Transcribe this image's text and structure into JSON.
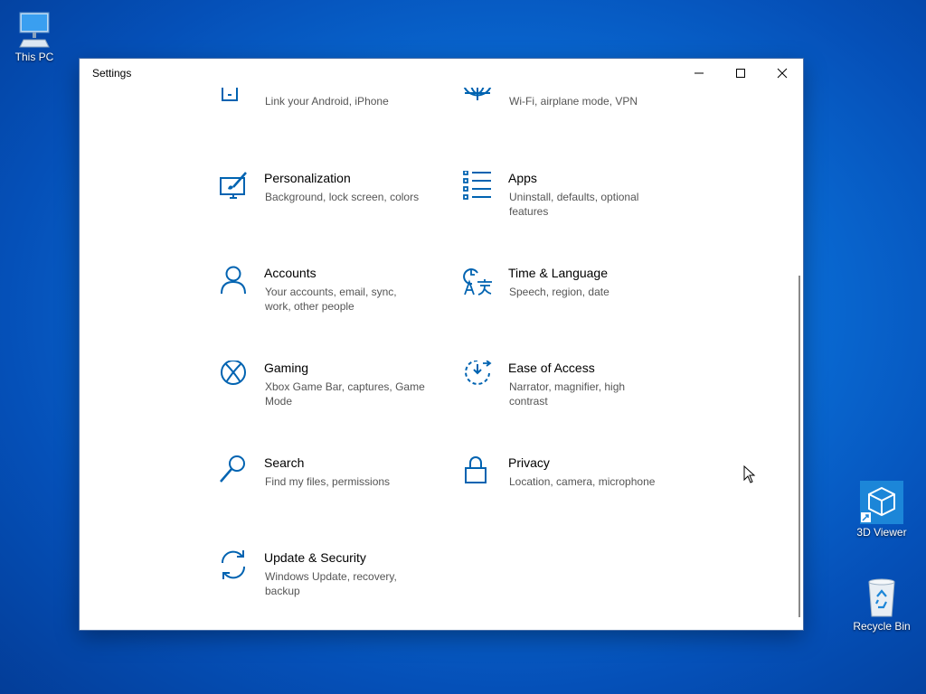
{
  "desktop": {
    "icons": [
      {
        "label": "This PC"
      },
      {
        "label": "3D Viewer"
      },
      {
        "label": "Recycle Bin"
      }
    ]
  },
  "window": {
    "title": "Settings",
    "controls": {
      "minimize": "minimize",
      "maximize": "maximize",
      "close": "close"
    }
  },
  "settings": {
    "items": [
      {
        "name": "",
        "desc": "Link your Android, iPhone",
        "icon": "phone-icon"
      },
      {
        "name": "",
        "desc": "Wi-Fi, airplane mode, VPN",
        "icon": "globe-icon"
      },
      {
        "name": "Personalization",
        "desc": "Background, lock screen, colors",
        "icon": "personalization-icon"
      },
      {
        "name": "Apps",
        "desc": "Uninstall, defaults, optional features",
        "icon": "apps-icon"
      },
      {
        "name": "Accounts",
        "desc": "Your accounts, email, sync, work, other people",
        "icon": "accounts-icon"
      },
      {
        "name": "Time & Language",
        "desc": "Speech, region, date",
        "icon": "time-language-icon"
      },
      {
        "name": "Gaming",
        "desc": "Xbox Game Bar, captures, Game Mode",
        "icon": "xbox-icon"
      },
      {
        "name": "Ease of Access",
        "desc": "Narrator, magnifier, high contrast",
        "icon": "ease-of-access-icon"
      },
      {
        "name": "Search",
        "desc": "Find my files, permissions",
        "icon": "search-icon"
      },
      {
        "name": "Privacy",
        "desc": "Location, camera, microphone",
        "icon": "lock-icon"
      },
      {
        "name": "Update & Security",
        "desc": "Windows Update, recovery, backup",
        "icon": "update-icon"
      }
    ]
  },
  "colors": {
    "accent": "#0063b1",
    "desktop": "#0a6fd8"
  }
}
